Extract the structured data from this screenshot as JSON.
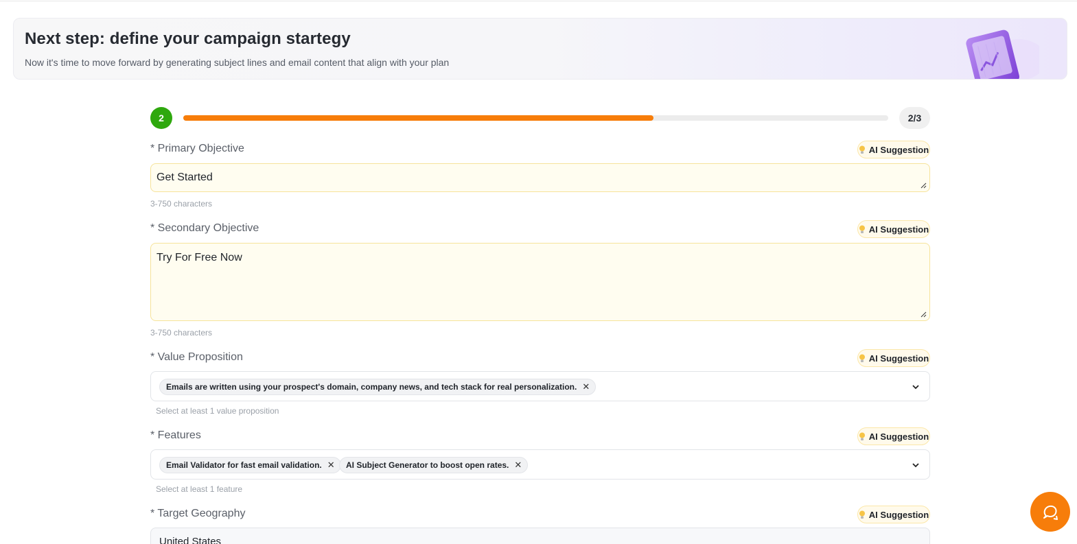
{
  "banner": {
    "title": "Next step: define your campaign startegy",
    "subtitle": "Now it's time to move forward by generating subject lines and email content that align with your plan"
  },
  "progress": {
    "step_number": "2",
    "step_count": "2/3",
    "fill_fraction": 0.667,
    "fill_color": "#f77d0a",
    "step_color": "#2fa80e"
  },
  "ai_suggestion_label": "AI Suggestion",
  "fields": {
    "primary": {
      "label": "* Primary Objective",
      "value": "Get Started",
      "hint": "3-750 characters"
    },
    "secondary": {
      "label": "* Secondary Objective",
      "value": "Try For Free Now",
      "hint": "3-750 characters"
    },
    "value_prop": {
      "label": "* Value Proposition",
      "tags": [
        "Emails are written using your prospect's domain, company news, and tech stack for real personalization."
      ],
      "hint": "Select at least 1 value proposition"
    },
    "features": {
      "label": "* Features",
      "tags": [
        "Email Validator for fast email validation.",
        "AI Subject Generator to boost open rates."
      ],
      "hint": "Select at least 1 feature"
    },
    "geography": {
      "label": "* Target Geography",
      "value": "United States"
    }
  },
  "icons": {
    "tag_remove": "close-icon",
    "dropdown": "chevron-down-icon",
    "ai": "lightbulb-icon",
    "chat": "chat-bubble-icon"
  },
  "colors": {
    "accent": "#f77d0a",
    "success": "#2fa80e",
    "highlight_bg": "#fffdf0"
  }
}
